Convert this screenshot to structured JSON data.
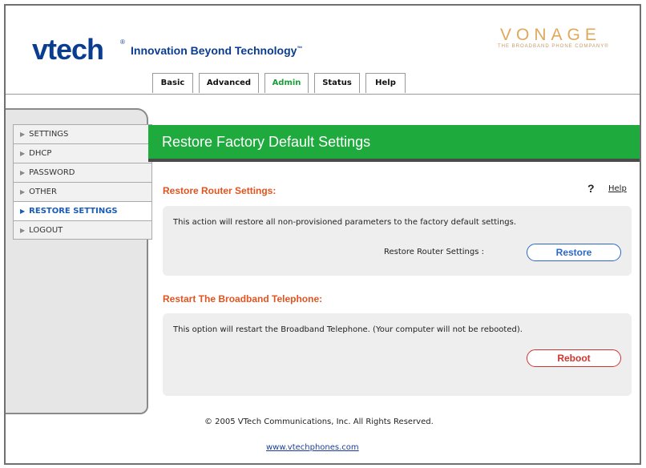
{
  "brand": {
    "logo_text": "vtech",
    "logo_mark": "®",
    "tagline": "Innovation Beyond Technology",
    "tagline_mark": "™",
    "partner": "VONAGE",
    "partner_sub": "THE BROADBAND PHONE COMPANY®"
  },
  "tabs": [
    {
      "label": "Basic"
    },
    {
      "label": "Advanced"
    },
    {
      "label": "Admin",
      "active": true
    },
    {
      "label": "Status"
    },
    {
      "label": "Help"
    }
  ],
  "sidebar": {
    "items": [
      {
        "label": "SETTINGS"
      },
      {
        "label": "DHCP"
      },
      {
        "label": "PASSWORD"
      },
      {
        "label": "OTHER"
      },
      {
        "label": "RESTORE SETTINGS",
        "active": true
      },
      {
        "label": "LOGOUT"
      }
    ]
  },
  "page": {
    "title": "Restore Factory Default Settings",
    "help_link": "Help",
    "help_glyph": "?"
  },
  "restore": {
    "heading": "Restore Router Settings:",
    "description": "This action will restore all non-provisioned parameters to the factory default settings.",
    "label": "Restore Router Settings :",
    "button": "Restore"
  },
  "restart": {
    "heading": "Restart The Broadband Telephone:",
    "description": "This option will restart the Broadband Telephone. (Your computer will not be rebooted).",
    "button": "Reboot"
  },
  "footer": {
    "copyright": "© 2005 VTech Communications, Inc. All Rights Reserved.",
    "link": "www.vtechphones.com"
  },
  "colors": {
    "accent_green": "#1faa3e",
    "heading_orange": "#e2541f",
    "logo_blue": "#0a3d8f",
    "restore_button": "#2a68c8",
    "reboot_button": "#d0332f"
  }
}
